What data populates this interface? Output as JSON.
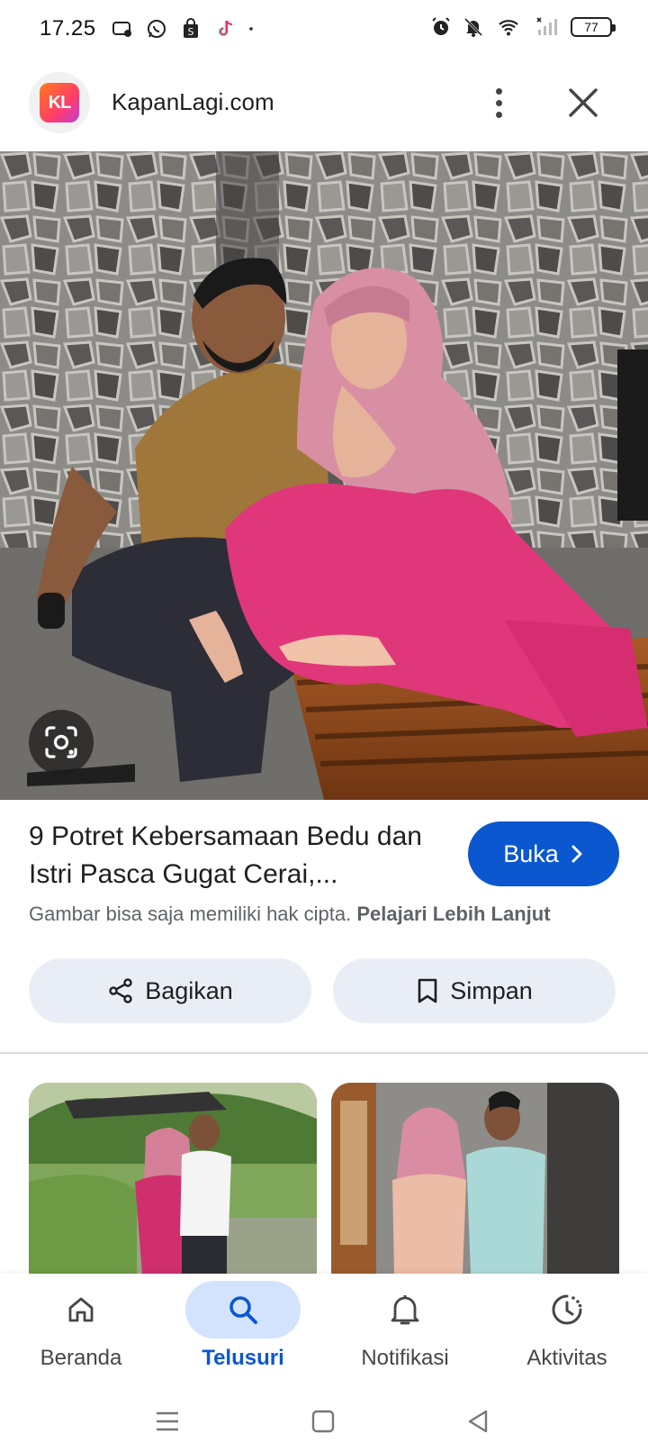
{
  "status_bar": {
    "time": "17.25",
    "battery": "77",
    "left_icons": [
      "caption-icon",
      "whatsapp-icon",
      "shopping-bag-icon",
      "tiktok-icon",
      "dot-icon"
    ],
    "right_icons": [
      "alarm-icon",
      "mute-icon",
      "wifi-icon",
      "signal-icon",
      "battery-icon"
    ]
  },
  "source": {
    "logo_text": "KL",
    "name": "KapanLagi.com"
  },
  "result": {
    "title": "9 Potret Kebersamaan Bedu dan Istri Pasca Gugat Cerai,...",
    "visit_label": "Buka",
    "copyright_text": "Gambar bisa saja memiliki hak cipta.",
    "learn_more": "Pelajari Lebih Lanjut"
  },
  "actions": {
    "share_label": "Bagikan",
    "save_label": "Simpan"
  },
  "bottom_nav": {
    "items": [
      {
        "label": "Beranda",
        "icon": "home-icon"
      },
      {
        "label": "Telusuri",
        "icon": "search-icon",
        "active": true
      },
      {
        "label": "Notifikasi",
        "icon": "bell-icon"
      },
      {
        "label": "Aktivitas",
        "icon": "activity-icon"
      }
    ]
  },
  "colors": {
    "accent": "#0b57d0",
    "chip_bg": "#e9eef6",
    "active_pill": "#d3e3fd"
  }
}
